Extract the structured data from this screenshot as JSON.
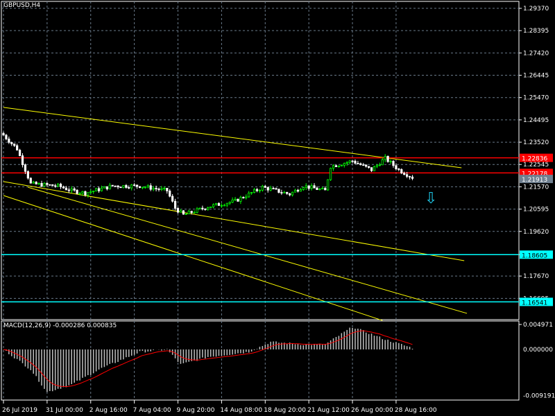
{
  "header": {
    "title": "GBPUSD,H4"
  },
  "macd": {
    "label": "MACD(12,26,9) -0.000286 0.000835",
    "max_label": "0.004971",
    "zero_label": "0.000000",
    "min_label": "-0.009191"
  },
  "chart_data": {
    "type": "candlestick",
    "symbol": "GBPUSD",
    "timeframe": "H4",
    "ylim": [
      1.156,
      1.2937
    ],
    "price_ticks": [
      "1.29370",
      "1.28395",
      "1.27420",
      "1.26445",
      "1.25470",
      "1.24495",
      "1.23520",
      "1.22545",
      "1.21570",
      "1.20595",
      "1.19620",
      "1.18605",
      "1.17670",
      "1.16695"
    ],
    "time_labels": [
      {
        "bar": 0,
        "label": "26 Jul 2019"
      },
      {
        "bar": 16,
        "label": "31 Jul 00:00"
      },
      {
        "bar": 32,
        "label": "2 Aug 16:00"
      },
      {
        "bar": 48,
        "label": "7 Aug 04:00"
      },
      {
        "bar": 64,
        "label": "9 Aug 20:00"
      },
      {
        "bar": 80,
        "label": "14 Aug 08:00"
      },
      {
        "bar": 96,
        "label": "18 Aug 20:00"
      },
      {
        "bar": 112,
        "label": "21 Aug 12:00"
      },
      {
        "bar": 128,
        "label": "26 Aug 00:00"
      },
      {
        "bar": 144,
        "label": "28 Aug 16:00"
      }
    ],
    "close_keypoints": [
      [
        0,
        1.2383
      ],
      [
        5,
        1.2322
      ],
      [
        8,
        1.2231
      ],
      [
        10,
        1.217
      ],
      [
        20,
        1.2161
      ],
      [
        25,
        1.214
      ],
      [
        30,
        1.213
      ],
      [
        40,
        1.2161
      ],
      [
        50,
        1.2161
      ],
      [
        60,
        1.214
      ],
      [
        63,
        1.2064
      ],
      [
        66,
        1.2034
      ],
      [
        75,
        1.207
      ],
      [
        85,
        1.2095
      ],
      [
        95,
        1.2155
      ],
      [
        105,
        1.2125
      ],
      [
        110,
        1.2161
      ],
      [
        118,
        1.214
      ],
      [
        120,
        1.2246
      ],
      [
        128,
        1.227
      ],
      [
        135,
        1.2231
      ],
      [
        140,
        1.2282
      ],
      [
        145,
        1.2231
      ],
      [
        150,
        1.2198
      ]
    ],
    "bars": 151,
    "horizontal_lines": [
      {
        "price": 1.22836,
        "label": "1.22836",
        "color": "#ff0000"
      },
      {
        "price": 1.22178,
        "label": "1.22178",
        "color": "#ff0000"
      },
      {
        "price": 1.21913,
        "label": "1.21913",
        "color": "#708090"
      },
      {
        "price": 1.18605,
        "label": "1.18605",
        "color": "#00ffff"
      },
      {
        "price": 1.16541,
        "label": "1.16541",
        "color": "#00ffff"
      }
    ],
    "trendlines": [
      [
        [
          0,
          1.2504
        ],
        [
          168,
          1.224
        ]
      ],
      [
        [
          0,
          1.218
        ],
        [
          169,
          1.1834
        ]
      ],
      [
        [
          0,
          1.2119
        ],
        [
          139,
          1.1573
        ]
      ],
      [
        [
          9,
          1.2155
        ],
        [
          170,
          1.1604
        ]
      ]
    ],
    "macd_keypoints": [
      [
        0,
        0
      ],
      [
        10,
        -0.004
      ],
      [
        16,
        -0.0085
      ],
      [
        25,
        -0.007
      ],
      [
        35,
        -0.004
      ],
      [
        50,
        -0.0005
      ],
      [
        60,
        0
      ],
      [
        65,
        -0.003
      ],
      [
        75,
        -0.0015
      ],
      [
        90,
        -0.0005
      ],
      [
        98,
        0.0015
      ],
      [
        110,
        0.001
      ],
      [
        118,
        0.001
      ],
      [
        128,
        0.0045
      ],
      [
        140,
        0.002
      ],
      [
        150,
        0.0003
      ]
    ],
    "macd_ylim": [
      -0.009191,
      0.004971
    ],
    "colors": {
      "bull": "#00ff00",
      "bear": "#ffffff",
      "grid": "#6a7a8a",
      "trend": "#ffff00",
      "signal": "#ff0000",
      "hist": "#c0c0c0"
    }
  }
}
